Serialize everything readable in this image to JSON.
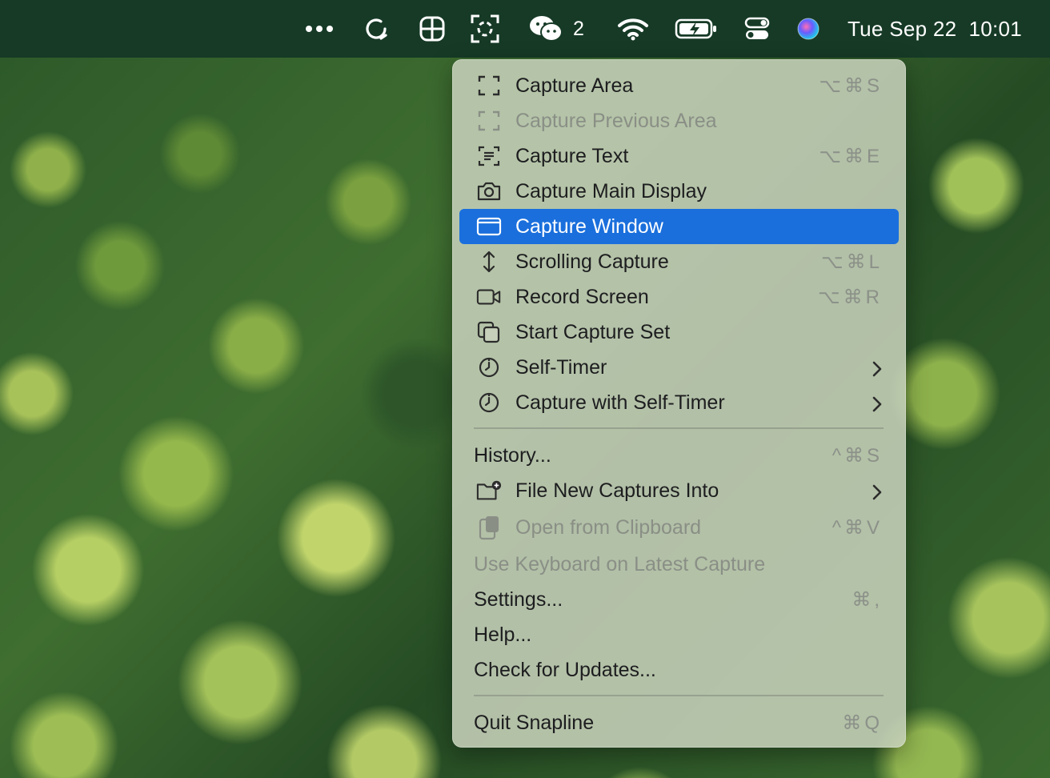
{
  "menubar": {
    "icons": [
      "more-icon",
      "snapline-status-icon",
      "grid-icon",
      "capture-icon",
      "wechat-icon",
      "wifi-icon",
      "battery-icon",
      "control-center-icon",
      "siri-icon"
    ],
    "wechat_count": "2",
    "date": "Tue Sep 22",
    "time": "10:01"
  },
  "menu": {
    "colors": {
      "highlight": "#1a6fdc",
      "disabled": "#8a8f86"
    },
    "items": [
      {
        "label": "Capture Area",
        "shortcut": "⌥⌘S",
        "icon": "capture-area-icon",
        "disabled": false
      },
      {
        "label": "Capture Previous Area",
        "shortcut": "",
        "icon": "capture-previous-area-icon",
        "disabled": true
      },
      {
        "label": "Capture Text",
        "shortcut": "⌥⌘E",
        "icon": "capture-text-icon",
        "disabled": false
      },
      {
        "label": "Capture Main Display",
        "shortcut": "",
        "icon": "camera-icon",
        "disabled": false
      },
      {
        "label": "Capture Window",
        "shortcut": "",
        "icon": "window-icon",
        "disabled": false,
        "highlighted": true
      },
      {
        "label": "Scrolling Capture",
        "shortcut": "⌥⌘L",
        "icon": "scroll-arrows-icon",
        "disabled": false
      },
      {
        "label": "Record Screen",
        "shortcut": "⌥⌘R",
        "icon": "video-camera-icon",
        "disabled": false
      },
      {
        "label": "Start Capture Set",
        "shortcut": "",
        "icon": "stacked-squares-icon",
        "disabled": false
      },
      {
        "label": "Self-Timer",
        "shortcut": "",
        "icon": "timer-icon",
        "disabled": false,
        "submenu": true
      },
      {
        "label": "Capture with Self-Timer",
        "shortcut": "",
        "icon": "timer-icon",
        "disabled": false,
        "submenu": true
      },
      {
        "label": "History...",
        "shortcut": "^⌘S",
        "disabled": false
      },
      {
        "label": "File New Captures Into",
        "shortcut": "",
        "icon": "folder-add-icon",
        "disabled": false,
        "submenu": true
      },
      {
        "label": "Open from Clipboard",
        "shortcut": "^⌘V",
        "icon": "clipboard-icon",
        "disabled": true
      },
      {
        "label": "Use Keyboard on Latest Capture",
        "shortcut": "",
        "disabled": true
      },
      {
        "label": "Settings...",
        "shortcut": "⌘,",
        "disabled": false
      },
      {
        "label": "Help...",
        "shortcut": "",
        "disabled": false
      },
      {
        "label": "Check for Updates...",
        "shortcut": "",
        "disabled": false
      },
      {
        "label": "Quit Snapline",
        "shortcut": "⌘Q",
        "disabled": false
      }
    ]
  }
}
